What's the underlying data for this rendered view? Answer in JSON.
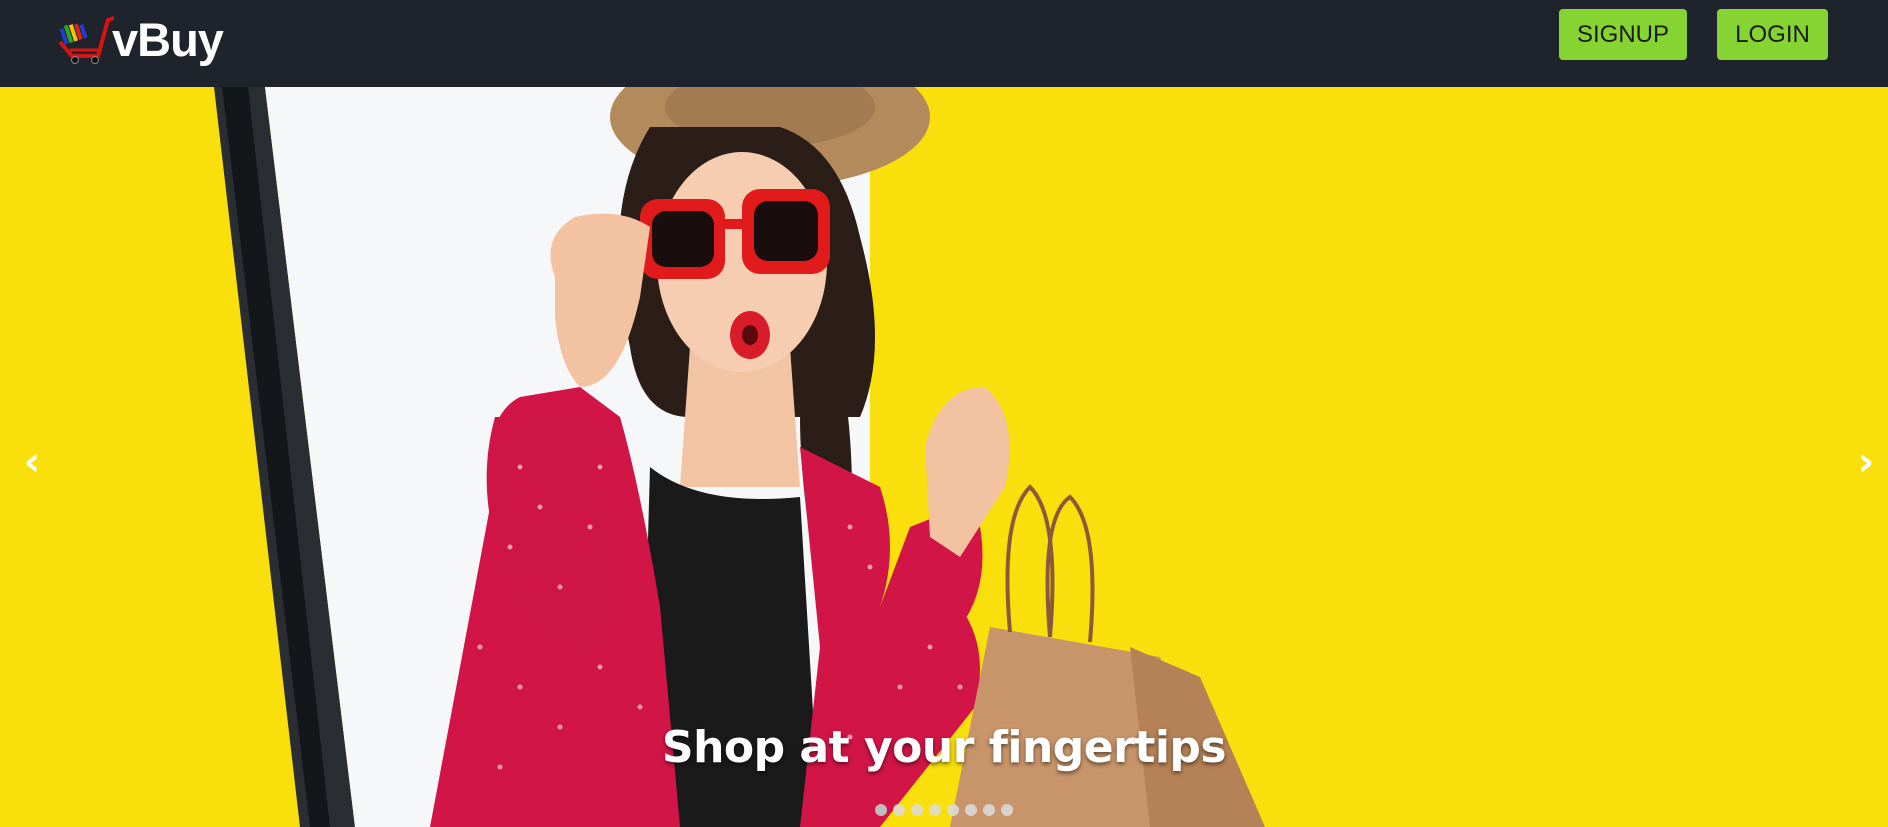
{
  "brand": {
    "name": "vBuy",
    "logo_icon": "shopping-cart-icon"
  },
  "nav": {
    "signup_label": "SIGNUP",
    "login_label": "LOGIN"
  },
  "carousel": {
    "caption": "Shop at your fingertips",
    "prev_symbol": "‹",
    "next_symbol": "›",
    "slide_count": 8,
    "active_index": 0
  },
  "colors": {
    "navbar_bg": "#1f242c",
    "button_bg": "#86d432",
    "hero_bg": "#f9df0b"
  }
}
